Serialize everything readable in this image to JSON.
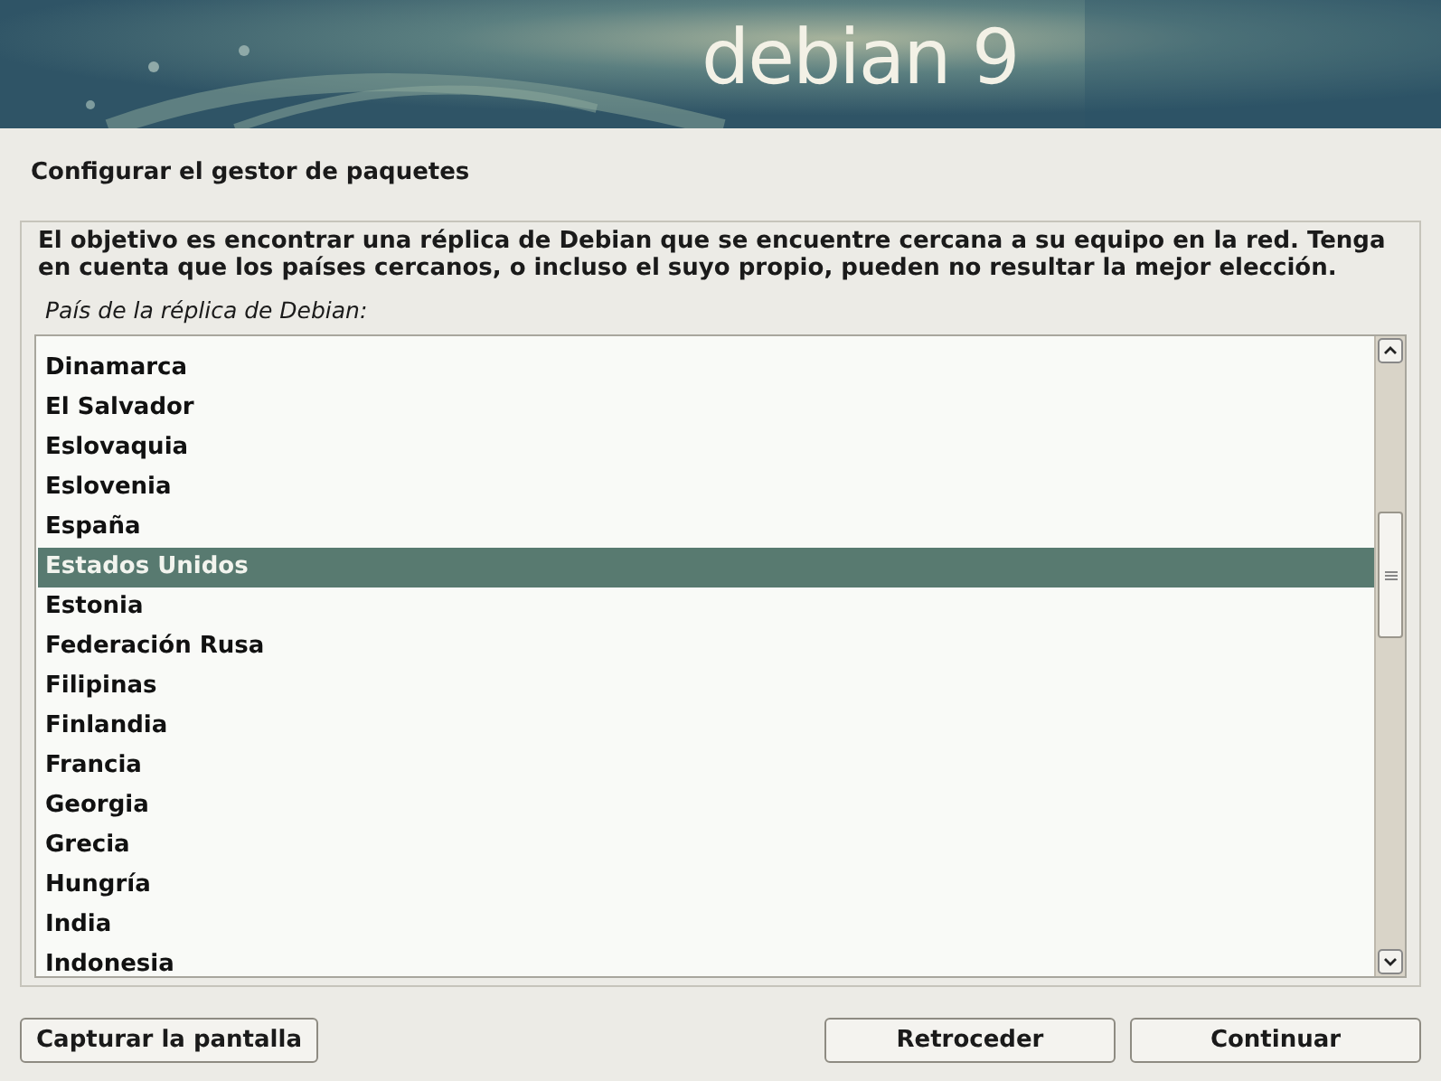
{
  "banner": {
    "logo": "debian 9"
  },
  "title": "Configurar el gestor de paquetes",
  "description": "El objetivo es encontrar una réplica de Debian que se encuentre cercana a su equipo en la red. Tenga en cuenta que los países cercanos, o incluso el suyo propio, pueden no resultar la mejor elección.",
  "list_label": "País de la réplica de Debian:",
  "countries": [
    {
      "label": "Dinamarca",
      "selected": false
    },
    {
      "label": "El Salvador",
      "selected": false
    },
    {
      "label": "Eslovaquia",
      "selected": false
    },
    {
      "label": "Eslovenia",
      "selected": false
    },
    {
      "label": "España",
      "selected": false
    },
    {
      "label": "Estados Unidos",
      "selected": true
    },
    {
      "label": "Estonia",
      "selected": false
    },
    {
      "label": "Federación Rusa",
      "selected": false
    },
    {
      "label": "Filipinas",
      "selected": false
    },
    {
      "label": "Finlandia",
      "selected": false
    },
    {
      "label": "Francia",
      "selected": false
    },
    {
      "label": "Georgia",
      "selected": false
    },
    {
      "label": "Grecia",
      "selected": false
    },
    {
      "label": "Hungría",
      "selected": false
    },
    {
      "label": "India",
      "selected": false
    },
    {
      "label": "Indonesia",
      "selected": false
    }
  ],
  "buttons": {
    "left": [
      "Capturar la pantalla"
    ],
    "right": [
      "Retroceder",
      "Continuar"
    ]
  }
}
